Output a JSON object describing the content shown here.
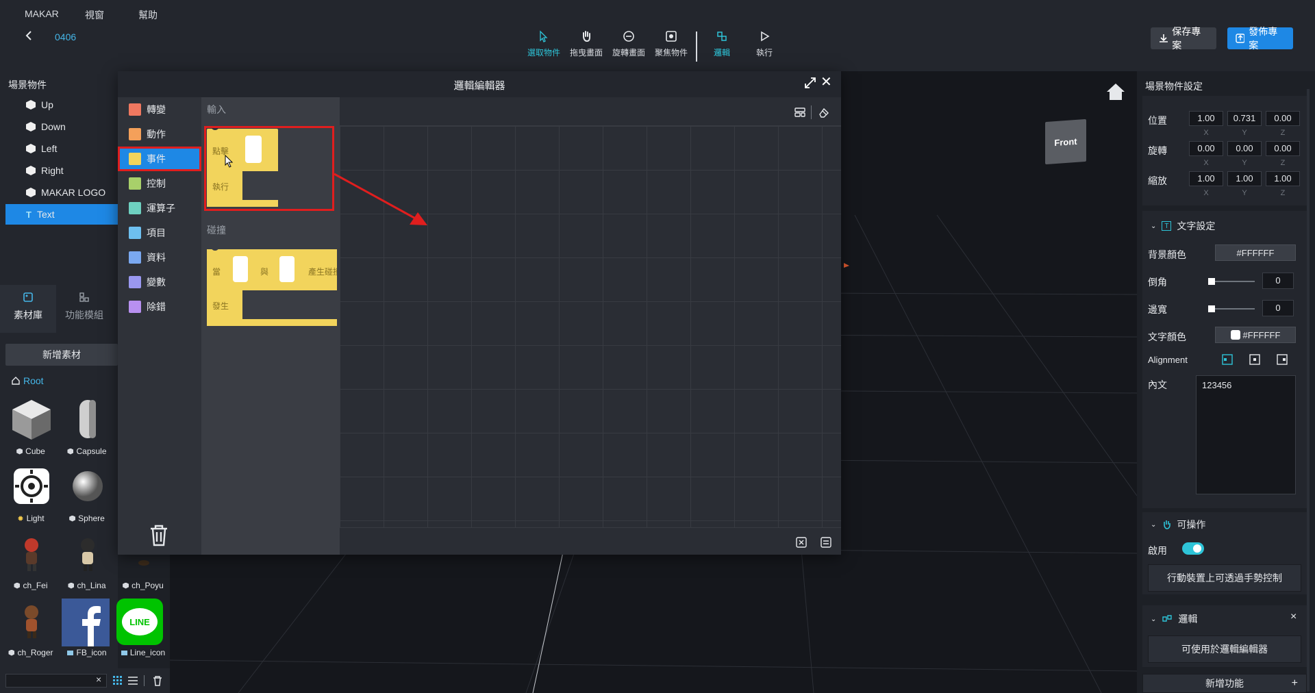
{
  "menu": [
    "MAKAR",
    "視窗",
    "幫助"
  ],
  "project_name": "0406",
  "tools": [
    {
      "label": "選取物件",
      "icon": "cursor-icon"
    },
    {
      "label": "拖曳畫面",
      "icon": "hand-icon"
    },
    {
      "label": "旋轉畫面",
      "icon": "rotate-icon"
    },
    {
      "label": "聚焦物件",
      "icon": "focus-icon"
    },
    {
      "label": "邏輯",
      "icon": "logic-icon"
    },
    {
      "label": "執行",
      "icon": "play-icon"
    }
  ],
  "active_tool": "邏輯",
  "save_label": "保存專案",
  "publish_label": "發佈專案",
  "scene": {
    "title": "場景物件",
    "items": [
      {
        "label": "Up",
        "icon": "cube-icon"
      },
      {
        "label": "Down",
        "icon": "cube-icon"
      },
      {
        "label": "Left",
        "icon": "cube-icon"
      },
      {
        "label": "Right",
        "icon": "cube-icon"
      },
      {
        "label": "MAKAR LOGO",
        "icon": "cube-icon"
      },
      {
        "label": "Text",
        "icon": "text-icon"
      }
    ],
    "selected": "Text"
  },
  "left_tabs": {
    "assets": "素材庫",
    "modules": "功能模組"
  },
  "add_asset": "新增素材",
  "root_label": "Root",
  "assets": [
    "Cube",
    "Capsule",
    "Light",
    "Sphere",
    "ch_Fei",
    "ch_Lina",
    "ch_Poyu",
    "ch_Roger",
    "FB_icon",
    "Line_icon"
  ],
  "line_logo_text": "LINE",
  "logic_editor": {
    "title": "邏輯編輯器",
    "categories": [
      {
        "label": "轉變",
        "color": "#f07860"
      },
      {
        "label": "動作",
        "color": "#f4a05a"
      },
      {
        "label": "事件",
        "color": "#f2d45c"
      },
      {
        "label": "控制",
        "color": "#a8d06a"
      },
      {
        "label": "運算子",
        "color": "#6ed0c0"
      },
      {
        "label": "項目",
        "color": "#6ec0f0"
      },
      {
        "label": "資料",
        "color": "#7aa8f0"
      },
      {
        "label": "變數",
        "color": "#9a98f0"
      },
      {
        "label": "除錯",
        "color": "#b890f0"
      }
    ],
    "selected_category": "事件",
    "input_label": "輸入",
    "collision_label": "碰撞",
    "block_click": {
      "line1": "點擊",
      "line2": "執行"
    },
    "block_collide": {
      "when": "當",
      "and": "與",
      "produce": "產生碰撞",
      "occur": "發生"
    }
  },
  "right": {
    "title": "場景物件設定",
    "transform": [
      {
        "label": "位置",
        "values": [
          "1.00",
          "0.731",
          "0.00"
        ]
      },
      {
        "label": "旋轉",
        "values": [
          "0.00",
          "0.00",
          "0.00"
        ]
      },
      {
        "label": "縮放",
        "values": [
          "1.00",
          "1.00",
          "1.00"
        ]
      }
    ],
    "axes": [
      "X",
      "Y",
      "Z"
    ],
    "text_settings": {
      "title": "文字設定",
      "bg_color_label": "背景顏色",
      "bg_color": "#FFFFFF",
      "corner_label": "倒角",
      "corner_value": "0",
      "border_label": "邊寬",
      "border_value": "0",
      "text_color_label": "文字顏色",
      "text_color": "#FFFFFF",
      "alignment_label": "Alignment",
      "content_label": "內文",
      "content_value": "123456"
    },
    "interact": {
      "title": "可操作",
      "enable_label": "啟用",
      "gesture_btn": "行動裝置上可透過手勢控制"
    },
    "logic": {
      "title": "邏輯",
      "btn": "可使用於邏輯編輯器",
      "close": "×"
    },
    "add_feature": "新增功能",
    "add_plus": "+"
  },
  "view_cube_label": "Front",
  "colors": {
    "accent": "#1e88e5",
    "cyan": "#2ec4d8",
    "annotation": "#e01e1e"
  }
}
